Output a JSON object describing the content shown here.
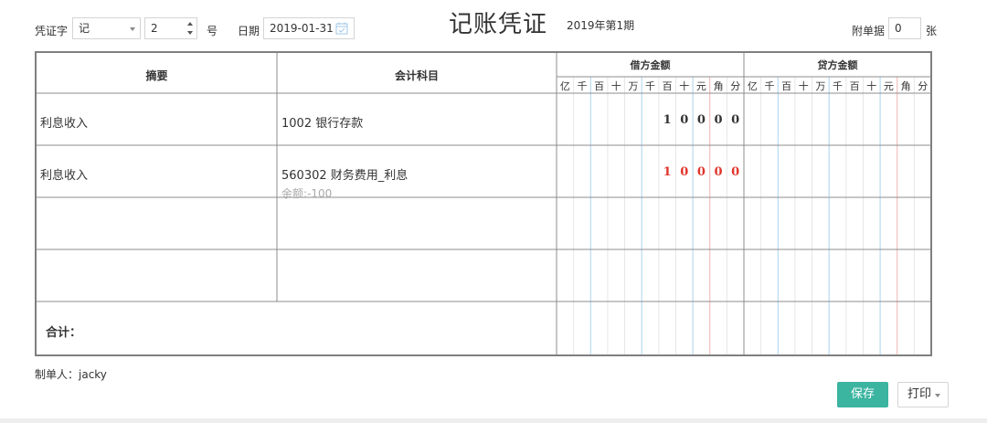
{
  "header": {
    "voucher_word_label": "凭证字",
    "voucher_word_value": "记",
    "voucher_number": "2",
    "number_suffix": "号",
    "date_label": "日期",
    "date_value": "2019-01-31",
    "title": "记账凭证",
    "period": "2019年第1期",
    "attachments_label": "附单据",
    "attachments_value": "0",
    "attachments_unit": "张"
  },
  "table": {
    "col_summary": "摘要",
    "col_account": "会计科目",
    "col_debit": "借方金额",
    "col_credit": "贷方金额",
    "units": [
      "亿",
      "千",
      "百",
      "十",
      "万",
      "千",
      "百",
      "十",
      "元",
      "角",
      "分"
    ],
    "rows": [
      {
        "summary": "利息收入",
        "account": "1002 银行存款",
        "balance_note": "",
        "debit_digits": [
          "1",
          "0",
          "0",
          "0",
          "0"
        ],
        "debit_color": "#333333"
      },
      {
        "summary": "利息收入",
        "account": "560302 财务费用_利息",
        "balance_note": "余额:-100",
        "debit_digits": [
          "1",
          "0",
          "0",
          "0",
          "0"
        ],
        "debit_color": "#e0352b"
      },
      {
        "summary": "",
        "account": "",
        "balance_note": "",
        "debit_digits": [],
        "debit_color": "#333333"
      },
      {
        "summary": "",
        "account": "",
        "balance_note": "",
        "debit_digits": [],
        "debit_color": "#333333"
      }
    ],
    "total_label": "合计："
  },
  "footer": {
    "maker": "制单人：jacky",
    "save_label": "保存",
    "print_label": "打印"
  },
  "colors": {
    "accent": "#3bb4a0",
    "negative_amount": "#e0352b",
    "gridline_blue": "#a9d3ee",
    "gridline_red": "#f0b4b4"
  }
}
